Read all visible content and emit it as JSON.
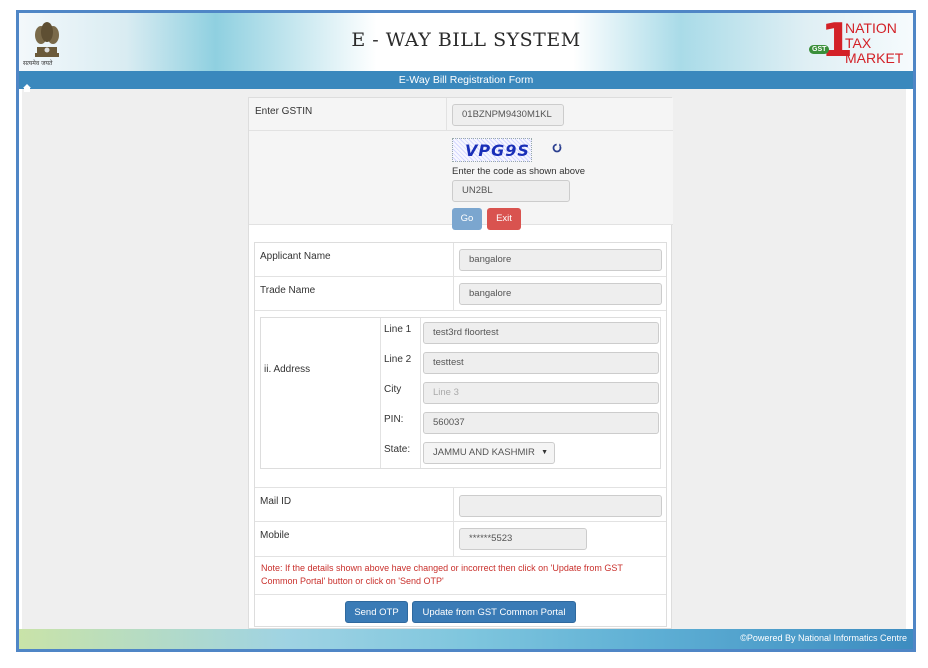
{
  "header": {
    "emblem_caption": "सत्यमेव जयते",
    "title": "E - WAY BILL SYSTEM",
    "logo": {
      "number": "1",
      "badge": "GST",
      "line1": "NATION",
      "line2": "TAX",
      "line3": "MARKET"
    }
  },
  "titlebar": {
    "title": "E-Way Bill Registration Form"
  },
  "form": {
    "gstin": {
      "label": "Enter GSTIN",
      "value": "01BZNPM9430M1KL"
    },
    "captcha": {
      "text": "VPG9S",
      "hint": "Enter the code as shown above",
      "value": "UN2BL"
    },
    "buttons": {
      "go": "Go",
      "exit": "Exit"
    },
    "applicant_name": {
      "label": "Applicant Name",
      "value": "bangalore"
    },
    "trade_name": {
      "label": "Trade Name",
      "value": "bangalore"
    },
    "address": {
      "label": "ii. Address",
      "line1": {
        "label": "Line 1",
        "value": "test3rd floortest"
      },
      "line2": {
        "label": "Line 2",
        "value": "testtest"
      },
      "city": {
        "label": "City",
        "placeholder": "Line 3"
      },
      "pin": {
        "label": "PIN:",
        "value": "560037"
      },
      "state": {
        "label": "State:",
        "value": "JAMMU AND KASHMIR"
      }
    },
    "mail": {
      "label": "Mail ID",
      "value": ""
    },
    "mobile": {
      "label": "Mobile",
      "value": "******5523"
    },
    "note": "Note: If the details shown above have changed or incorrect then click on 'Update from GST Common Portal' button or click on 'Send OTP'",
    "send_otp": "Send OTP",
    "update": "Update from GST Common Portal"
  },
  "footer": {
    "text": "©Powered By National Informatics Centre"
  },
  "colors": {
    "titlebar": "#3a88bd",
    "primary_button": "#3a7bb6",
    "exit_button": "#d9534f",
    "note_text": "#c9302c"
  }
}
